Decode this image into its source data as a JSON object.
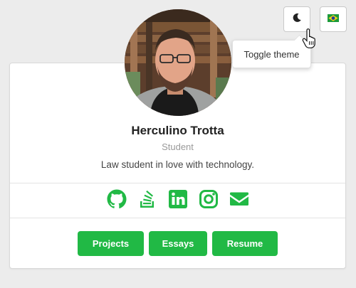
{
  "profile": {
    "name": "Herculino Trotta",
    "role": "Student",
    "bio": "Law student in love with technology."
  },
  "social": [
    {
      "icon": "github-icon"
    },
    {
      "icon": "stackoverflow-icon"
    },
    {
      "icon": "linkedin-icon"
    },
    {
      "icon": "instagram-icon"
    },
    {
      "icon": "email-icon"
    }
  ],
  "buttons": {
    "projects": "Projects",
    "essays": "Essays",
    "resume": "Resume"
  },
  "toolbar": {
    "theme_icon": "moon-icon",
    "language_icon": "brazil-flag-icon",
    "tooltip": "Toggle theme"
  },
  "colors": {
    "accent": "#21b945",
    "background": "#ececec",
    "card": "#ffffff"
  }
}
